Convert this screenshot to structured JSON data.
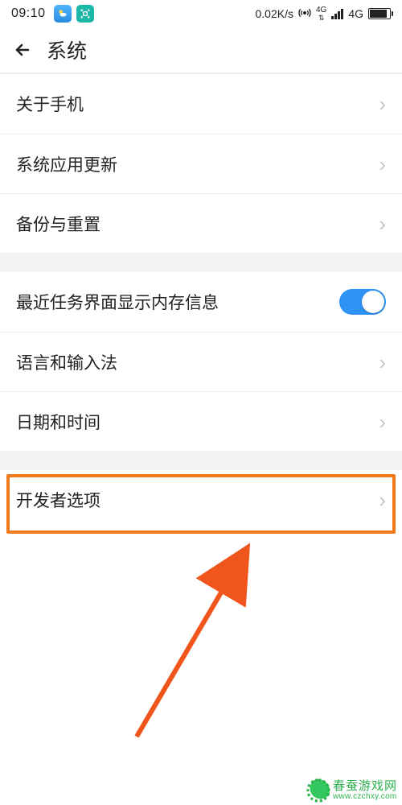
{
  "status": {
    "time": "09:10",
    "net_speed": "0.02K/s",
    "net_badge": "4G",
    "net_label": "4G"
  },
  "header": {
    "title": "系统"
  },
  "section1": {
    "items": [
      {
        "label": "关于手机"
      },
      {
        "label": "系统应用更新"
      },
      {
        "label": "备份与重置"
      }
    ]
  },
  "section2": {
    "toggle_label": "最近任务界面显示内存信息",
    "toggle_on": true,
    "items": [
      {
        "label": "语言和输入法"
      },
      {
        "label": "日期和时间"
      }
    ]
  },
  "section3": {
    "items": [
      {
        "label": "开发者选项"
      }
    ]
  },
  "watermark": {
    "text": "春蚕游戏网",
    "url": "www.czchxy.com"
  },
  "colors": {
    "accent": "#2f93f6",
    "highlight": "#f07a1c",
    "brand_green": "#2bb14b"
  }
}
